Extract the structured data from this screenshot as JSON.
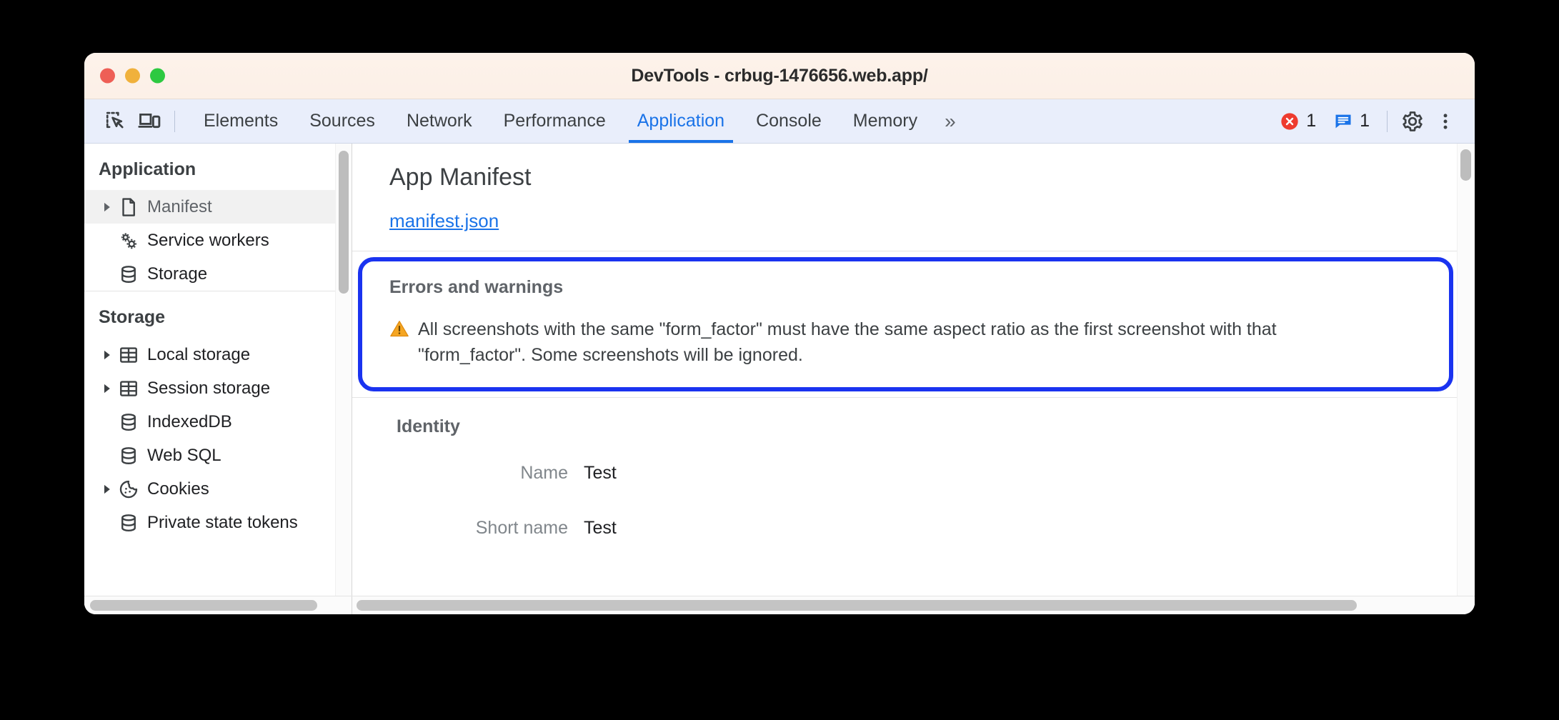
{
  "window": {
    "title": "DevTools - crbug-1476656.web.app/",
    "traffic_lights": [
      "close",
      "minimize",
      "maximize"
    ]
  },
  "toolbar": {
    "inspect_icon": "inspect-element-icon",
    "device_icon": "device-toolbar-icon",
    "tabs": [
      {
        "label": "Elements",
        "active": false
      },
      {
        "label": "Sources",
        "active": false
      },
      {
        "label": "Network",
        "active": false
      },
      {
        "label": "Performance",
        "active": false
      },
      {
        "label": "Application",
        "active": true
      },
      {
        "label": "Console",
        "active": false
      },
      {
        "label": "Memory",
        "active": false
      }
    ],
    "more_tabs_label": "»",
    "error_count": "1",
    "message_count": "1",
    "settings_icon": "gear-icon",
    "menu_icon": "kebab-menu-icon",
    "accent_color": "#1a73e8",
    "error_color": "#ee3b2f",
    "message_color": "#1a73e8"
  },
  "sidebar": {
    "groups": [
      {
        "title": "Application",
        "items": [
          {
            "label": "Manifest",
            "icon": "document-icon",
            "twisty": true,
            "selected": true
          },
          {
            "label": "Service workers",
            "icon": "gears-icon",
            "twisty": false,
            "selected": false
          },
          {
            "label": "Storage",
            "icon": "database-icon",
            "twisty": false,
            "selected": false
          }
        ]
      },
      {
        "title": "Storage",
        "items": [
          {
            "label": "Local storage",
            "icon": "table-icon",
            "twisty": true,
            "selected": false
          },
          {
            "label": "Session storage",
            "icon": "table-icon",
            "twisty": true,
            "selected": false
          },
          {
            "label": "IndexedDB",
            "icon": "database-icon",
            "twisty": false,
            "selected": false
          },
          {
            "label": "Web SQL",
            "icon": "database-icon",
            "twisty": false,
            "selected": false
          },
          {
            "label": "Cookies",
            "icon": "cookie-icon",
            "twisty": true,
            "selected": false
          },
          {
            "label": "Private state tokens",
            "icon": "database-icon",
            "twisty": false,
            "selected": false
          }
        ]
      }
    ]
  },
  "main": {
    "page_title": "App Manifest",
    "manifest_link": "manifest.json",
    "errors": {
      "title": "Errors and warnings",
      "highlight_color": "#1a33f0",
      "items": [
        {
          "icon": "warning-triangle-icon",
          "text": "All screenshots with the same \"form_factor\" must have the same aspect ratio as the first screenshot with that \"form_factor\". Some screenshots will be ignored."
        }
      ]
    },
    "identity": {
      "title": "Identity",
      "fields": [
        {
          "label": "Name",
          "value": "Test"
        },
        {
          "label": "Short name",
          "value": "Test"
        }
      ]
    }
  }
}
